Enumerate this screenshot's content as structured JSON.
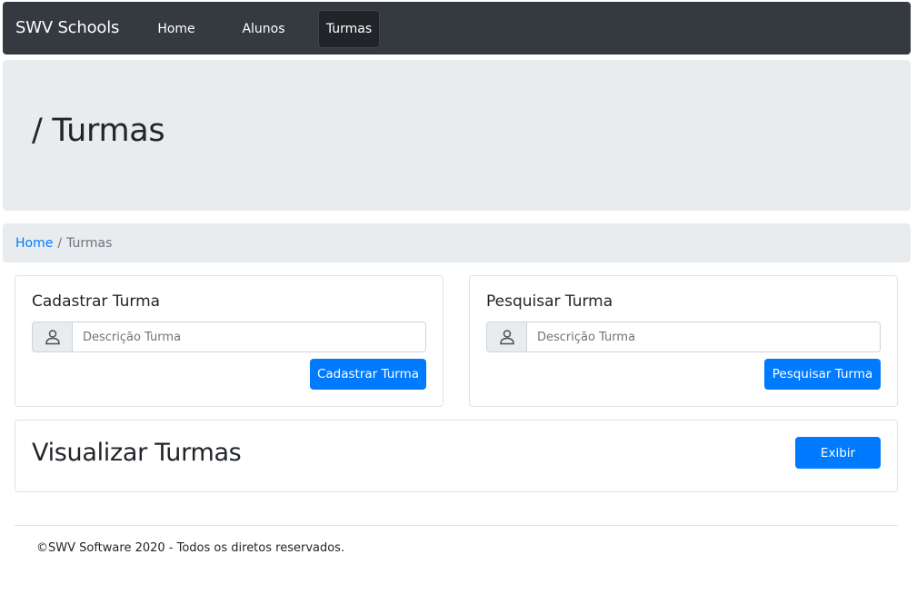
{
  "navbar": {
    "brand": "SWV Schools",
    "items": [
      {
        "label": "Home",
        "active": false
      },
      {
        "label": "Alunos",
        "active": false
      },
      {
        "label": "Turmas",
        "active": true
      }
    ]
  },
  "jumbotron": {
    "title": "/ Turmas"
  },
  "breadcrumb": {
    "home": "Home",
    "separator": "/",
    "current": "Turmas"
  },
  "cadastrar": {
    "title": "Cadastrar Turma",
    "input_icon": "user-icon",
    "placeholder": "Descrição Turma",
    "value": "",
    "button": "Cadastrar Turma"
  },
  "pesquisar": {
    "title": "Pesquisar Turma",
    "input_icon": "user-icon",
    "placeholder": "Descrição Turma",
    "value": "",
    "button": "Pesquisar Turma"
  },
  "visualizar": {
    "title": "Visualizar Turmas",
    "button": "Exibir"
  },
  "footer": {
    "text": "©SWV Software 2020 - Todos os diretos reservados."
  },
  "colors": {
    "navbar": "#343a40",
    "primary": "#007bff",
    "jumbotron": "#e9ecef"
  }
}
